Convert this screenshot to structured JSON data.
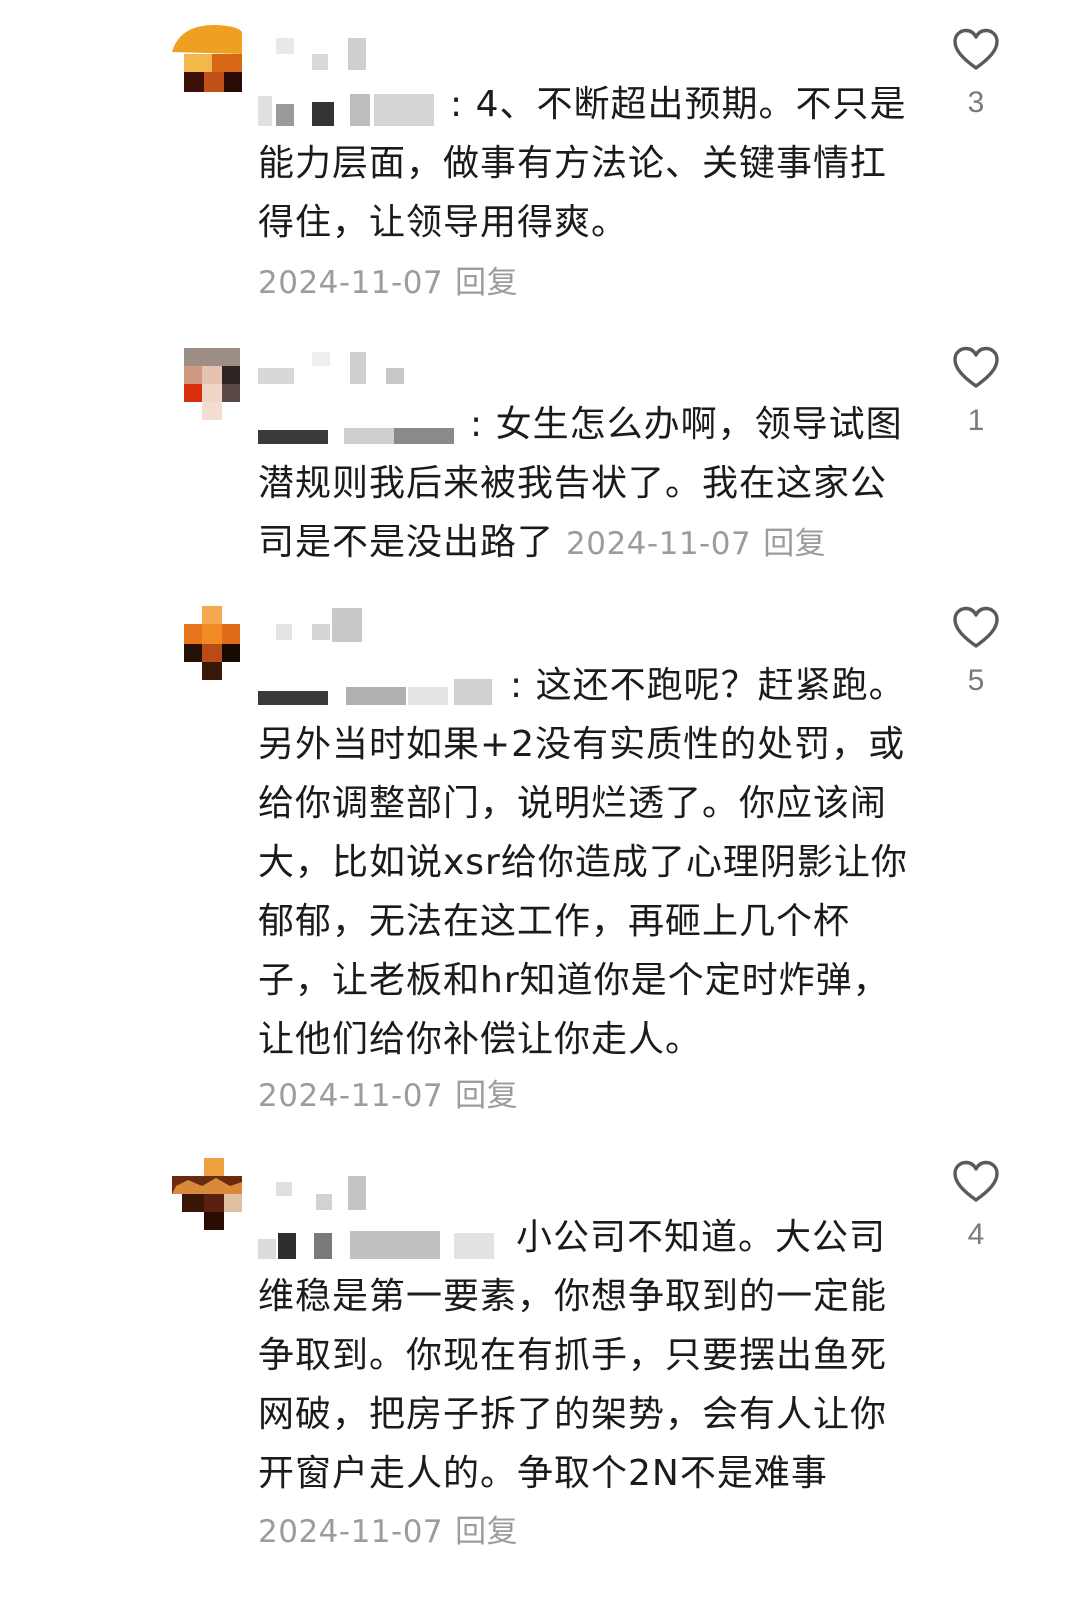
{
  "comments": [
    {
      "text": ": 4、不断超出预期。不只是能力层面，做事有方法论、关键事情扛得住，让领导用得爽。",
      "date": "2024-11-07",
      "reply_label": "回复",
      "likes": "3",
      "like_icon": "heart-outline-icon"
    },
    {
      "text": ": 女生怎么办啊，领导试图潜规则我后来被我告状了。我在这家公司是不是没出路了",
      "date": "2024-11-07",
      "reply_label": "回复",
      "likes": "1",
      "like_icon": "heart-outline-icon"
    },
    {
      "text": ": 这还不跑呢？赶紧跑。另外当时如果+2没有实质性的处罚，或给你调整部门，说明烂透了。你应该闹大，比如说xsr给你造成了心理阴影让你郁郁，无法在这工作，再砸上几个杯子，让老板和hr知道你是个定时炸弹，让他们给你补偿让你走人。",
      "date": "2024-11-07",
      "reply_label": "回复",
      "likes": "5",
      "like_icon": "heart-outline-icon"
    },
    {
      "text": "小公司不知道。大公司维稳是第一要素，你想争取到的一定能争取到。你现在有抓手，只要摆出鱼死网破，把房子拆了的架势，会有人让你开窗户走人的。争取个2N不是难事",
      "date": "2024-11-07",
      "reply_label": "回复",
      "likes": "4",
      "like_icon": "heart-outline-icon"
    }
  ],
  "colors": {
    "text": "#1b1b1b",
    "meta": "#9c9c9c",
    "heart": "#5a5a5a"
  }
}
